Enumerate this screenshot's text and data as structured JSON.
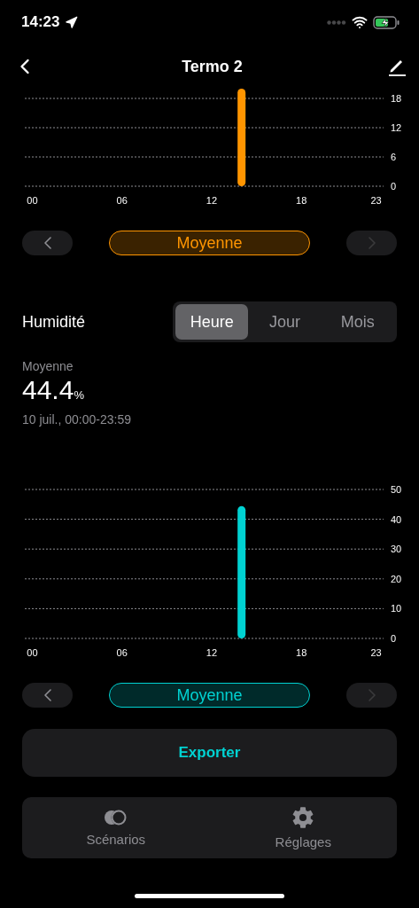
{
  "status_bar": {
    "time": "14:23"
  },
  "nav": {
    "title": "Termo 2"
  },
  "temperature": {
    "chart_data": {
      "type": "bar",
      "x": [
        14
      ],
      "xlim": [
        -0.5,
        23.5
      ],
      "grid": true,
      "series": [
        {
          "color": "#ff9500",
          "values": [
            20
          ]
        }
      ],
      "xticks": [
        {
          "value": 0,
          "label": "00"
        },
        {
          "value": 6,
          "label": "06"
        },
        {
          "value": 12,
          "label": "12"
        },
        {
          "value": 18,
          "label": "18"
        },
        {
          "value": 23,
          "label": "23"
        }
      ],
      "ylim": [
        0,
        20
      ],
      "yticks": [
        0,
        6,
        12,
        18
      ]
    },
    "pager": {
      "label": "Moyenne",
      "prev_disabled": false,
      "next_disabled": true
    }
  },
  "humidity": {
    "title": "Humidité",
    "segments": [
      {
        "label": "Heure",
        "selected": true
      },
      {
        "label": "Jour",
        "selected": false
      },
      {
        "label": "Mois",
        "selected": false
      }
    ],
    "summary": {
      "label": "Moyenne",
      "value": "44.4",
      "unit": "%",
      "range": "10 juil., 00:00-23:59"
    },
    "chart_data": {
      "type": "bar",
      "x": [
        14
      ],
      "xlim": [
        -0.5,
        23.5
      ],
      "grid": true,
      "series": [
        {
          "color": "#00d2d2",
          "values": [
            44.4
          ]
        }
      ],
      "xticks": [
        {
          "value": 0,
          "label": "00"
        },
        {
          "value": 6,
          "label": "06"
        },
        {
          "value": 12,
          "label": "12"
        },
        {
          "value": 18,
          "label": "18"
        },
        {
          "value": 23,
          "label": "23"
        }
      ],
      "ylim": [
        0,
        50
      ],
      "yticks": [
        0,
        10,
        20,
        30,
        40,
        50
      ]
    },
    "pager": {
      "label": "Moyenne",
      "prev_disabled": false,
      "next_disabled": true
    }
  },
  "export_button": {
    "label": "Exporter"
  },
  "tab_bar": [
    {
      "kind": "scenes",
      "label": "Scénarios"
    },
    {
      "kind": "settings",
      "label": "Réglages"
    }
  ]
}
